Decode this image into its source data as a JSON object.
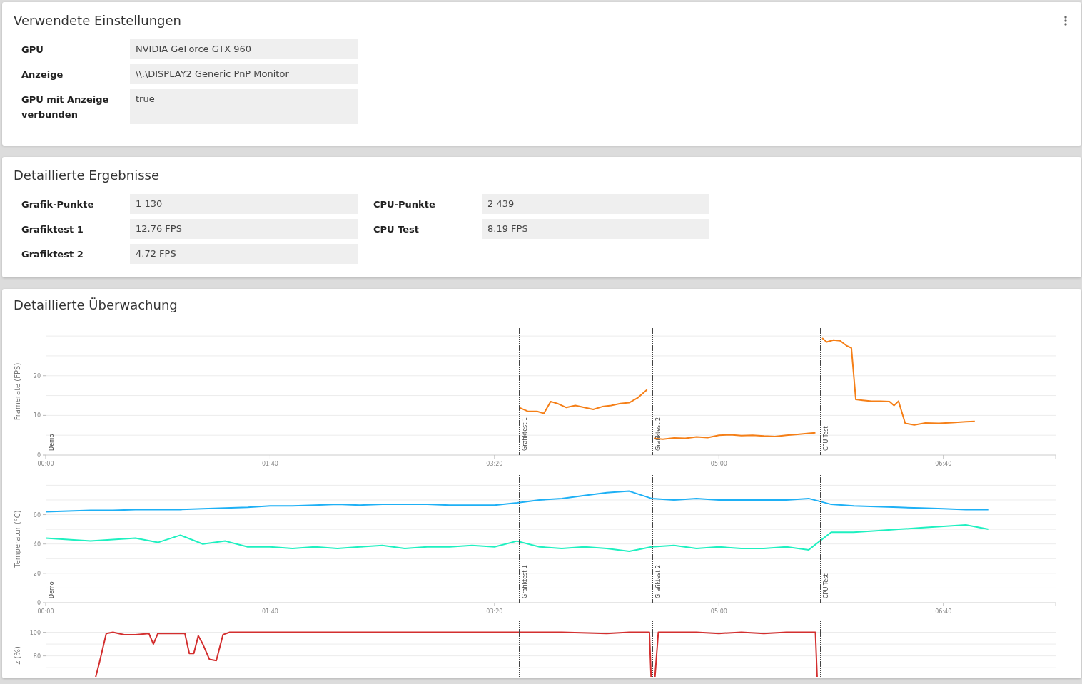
{
  "settings_card": {
    "title": "Verwendete Einstellungen",
    "rows": [
      {
        "label": "GPU",
        "value": "NVIDIA GeForce GTX 960"
      },
      {
        "label": "Anzeige",
        "value": "\\\\.\\DISPLAY2 Generic PnP Monitor"
      },
      {
        "label": "GPU mit Anzeige verbunden",
        "value": "true"
      }
    ]
  },
  "results_card": {
    "title": "Detaillierte Ergebnisse",
    "columns": [
      [
        {
          "label": "Grafik-Punkte",
          "value": "1 130"
        },
        {
          "label": "Grafiktest 1",
          "value": "12.76 FPS"
        },
        {
          "label": "Grafiktest 2",
          "value": "4.72 FPS"
        }
      ],
      [
        {
          "label": "CPU-Punkte",
          "value": "2 439"
        },
        {
          "label": "CPU Test",
          "value": "8.19 FPS"
        }
      ]
    ]
  },
  "monitoring_card": {
    "title": "Detaillierte Überwachung",
    "charts": [
      {
        "chart_data": {
          "type": "line",
          "ylabel": "Framerate (FPS)",
          "xlim": [
            0,
            450
          ],
          "ylim": [
            0,
            32
          ],
          "yticks": [
            0,
            10,
            20
          ],
          "xticks": [
            {
              "value": 0,
              "label": "00:00"
            },
            {
              "value": 100,
              "label": "01:40"
            },
            {
              "value": 200,
              "label": "03:20"
            },
            {
              "value": 300,
              "label": "05:00"
            },
            {
              "value": 400,
              "label": "06:40"
            }
          ],
          "grid": true,
          "ref_lines": [
            {
              "axis": "x",
              "value": 0,
              "label": "Demo"
            },
            {
              "axis": "x",
              "value": 210.8,
              "label": "Grafiktest 1"
            },
            {
              "axis": "x",
              "value": 270.4,
              "label": "Grafiktest 2"
            },
            {
              "axis": "x",
              "value": 345,
              "label": "CPU Test"
            }
          ],
          "x": [
            211,
            215,
            219,
            222,
            225,
            228,
            232,
            236,
            240,
            244,
            248,
            252,
            256,
            260,
            264,
            268,
            271,
            275,
            280,
            285,
            290,
            295,
            300,
            305,
            310,
            315,
            320,
            325,
            330,
            335,
            340,
            343,
            346,
            348,
            351,
            354,
            357,
            359,
            361,
            364,
            368,
            372,
            376,
            378,
            380,
            383,
            387,
            392,
            398,
            404,
            410,
            414
          ],
          "series": [
            {
              "color": "#f57f17",
              "values": [
                12,
                11,
                11,
                10.5,
                13.5,
                13,
                12,
                12.5,
                12,
                11.5,
                12.2,
                12.5,
                13,
                13.2,
                14.5,
                16.5,
                null,
                null,
                null,
                null,
                null,
                null,
                null,
                null,
                null,
                null,
                null,
                null,
                null,
                null,
                null,
                null,
                null,
                null,
                null,
                null,
                null,
                null,
                null,
                null,
                null,
                null,
                null,
                null,
                null,
                null,
                null,
                null,
                null,
                null,
                null,
                null
              ]
            },
            {
              "color": "#f57f17",
              "values": [
                null,
                null,
                null,
                null,
                null,
                null,
                null,
                null,
                null,
                null,
                null,
                null,
                null,
                null,
                null,
                null,
                4.2,
                4,
                4.3,
                4.2,
                4.6,
                4.4,
                5,
                5.1,
                4.9,
                5,
                4.8,
                4.7,
                5,
                5.2,
                5.5,
                5.6,
                null,
                null,
                null,
                null,
                null,
                null,
                null,
                null,
                null,
                null,
                null,
                null,
                null,
                null,
                null,
                null,
                null,
                null,
                null,
                null
              ]
            },
            {
              "color": "#f57f17",
              "values": [
                null,
                null,
                null,
                null,
                null,
                null,
                null,
                null,
                null,
                null,
                null,
                null,
                null,
                null,
                null,
                null,
                null,
                null,
                null,
                null,
                null,
                null,
                null,
                null,
                null,
                null,
                null,
                null,
                null,
                null,
                null,
                null,
                29.5,
                28.5,
                29,
                28.8,
                27.5,
                27,
                14,
                13.8,
                13.6,
                13.6,
                13.5,
                12.5,
                13.6,
                8,
                7.6,
                8.1,
                8,
                8.2,
                8.4,
                8.5
              ]
            }
          ]
        }
      },
      {
        "chart_data": {
          "type": "line",
          "ylabel": "Temperatur (°C)",
          "xlim": [
            0,
            450
          ],
          "ylim": [
            0,
            87
          ],
          "yticks": [
            0,
            20,
            40,
            60
          ],
          "grid": true,
          "xticks": [
            {
              "value": 0,
              "label": "00:00"
            },
            {
              "value": 100,
              "label": "01:40"
            },
            {
              "value": 200,
              "label": "03:20"
            },
            {
              "value": 300,
              "label": "05:00"
            },
            {
              "value": 400,
              "label": "06:40"
            }
          ],
          "ref_lines": [
            {
              "axis": "x",
              "value": 0,
              "label": "Demo"
            },
            {
              "axis": "x",
              "value": 210.8,
              "label": "Grafiktest 1"
            },
            {
              "axis": "x",
              "value": 270.4,
              "label": "Grafiktest 2"
            },
            {
              "axis": "x",
              "value": 345,
              "label": "CPU Test"
            }
          ],
          "x": [
            0,
            10,
            20,
            30,
            40,
            50,
            60,
            70,
            80,
            90,
            100,
            110,
            120,
            130,
            140,
            150,
            160,
            170,
            180,
            190,
            200,
            210,
            220,
            230,
            240,
            250,
            260,
            270,
            280,
            290,
            300,
            310,
            320,
            330,
            340,
            350,
            360,
            370,
            380,
            390,
            400,
            410,
            420
          ],
          "series": [
            {
              "color": "#1eb0f5",
              "values": [
                62,
                62.5,
                63,
                63,
                63.5,
                63.5,
                63.5,
                64,
                64.5,
                65,
                66,
                66,
                66.5,
                67,
                66.5,
                67,
                67,
                67,
                66.5,
                66.5,
                66.5,
                68,
                70,
                71,
                73,
                75,
                76,
                71,
                70,
                71,
                70,
                70,
                70,
                70,
                71,
                67,
                66,
                65.5,
                65,
                64.5,
                64,
                63.5,
                63.5
              ]
            },
            {
              "color": "#1ef0c0",
              "values": [
                44,
                43,
                42,
                43,
                44,
                41,
                46,
                40,
                42,
                38,
                38,
                37,
                38,
                37,
                38,
                39,
                37,
                38,
                38,
                39,
                38,
                42,
                38,
                37,
                38,
                37,
                35,
                38,
                39,
                37,
                38,
                37,
                37,
                38,
                36,
                48,
                48,
                49,
                50,
                51,
                52,
                53,
                50
              ]
            }
          ]
        }
      },
      {
        "chart_data": {
          "type": "line",
          "ylabel": "z (%)",
          "xlim": [
            0,
            450
          ],
          "ylim": [
            0,
            110
          ],
          "yticks": [
            80,
            100
          ],
          "grid": true,
          "ref_lines": [
            {
              "axis": "x",
              "value": 0
            },
            {
              "axis": "x",
              "value": 210.8
            },
            {
              "axis": "x",
              "value": 270.4
            },
            {
              "axis": "x",
              "value": 345
            }
          ],
          "x": [
            22,
            24,
            27,
            30,
            35,
            40,
            46,
            48,
            50,
            55,
            62,
            64,
            66,
            68,
            70,
            73,
            76,
            79,
            82,
            100,
            130,
            150,
            180,
            200,
            230,
            250,
            260,
            269,
            270,
            271,
            273,
            290,
            300,
            310,
            320,
            330,
            343,
            344
          ],
          "series": [
            {
              "color": "#d32f2f",
              "values": [
                60,
                75,
                99,
                100,
                98,
                98,
                99,
                90,
                99,
                99,
                99,
                82,
                82,
                97,
                90,
                77,
                76,
                98,
                100,
                100,
                100,
                100,
                100,
                100,
                100,
                99,
                100,
                100,
                50,
                50,
                100,
                100,
                99,
                100,
                99,
                100,
                100,
                50
              ]
            }
          ]
        }
      }
    ]
  }
}
